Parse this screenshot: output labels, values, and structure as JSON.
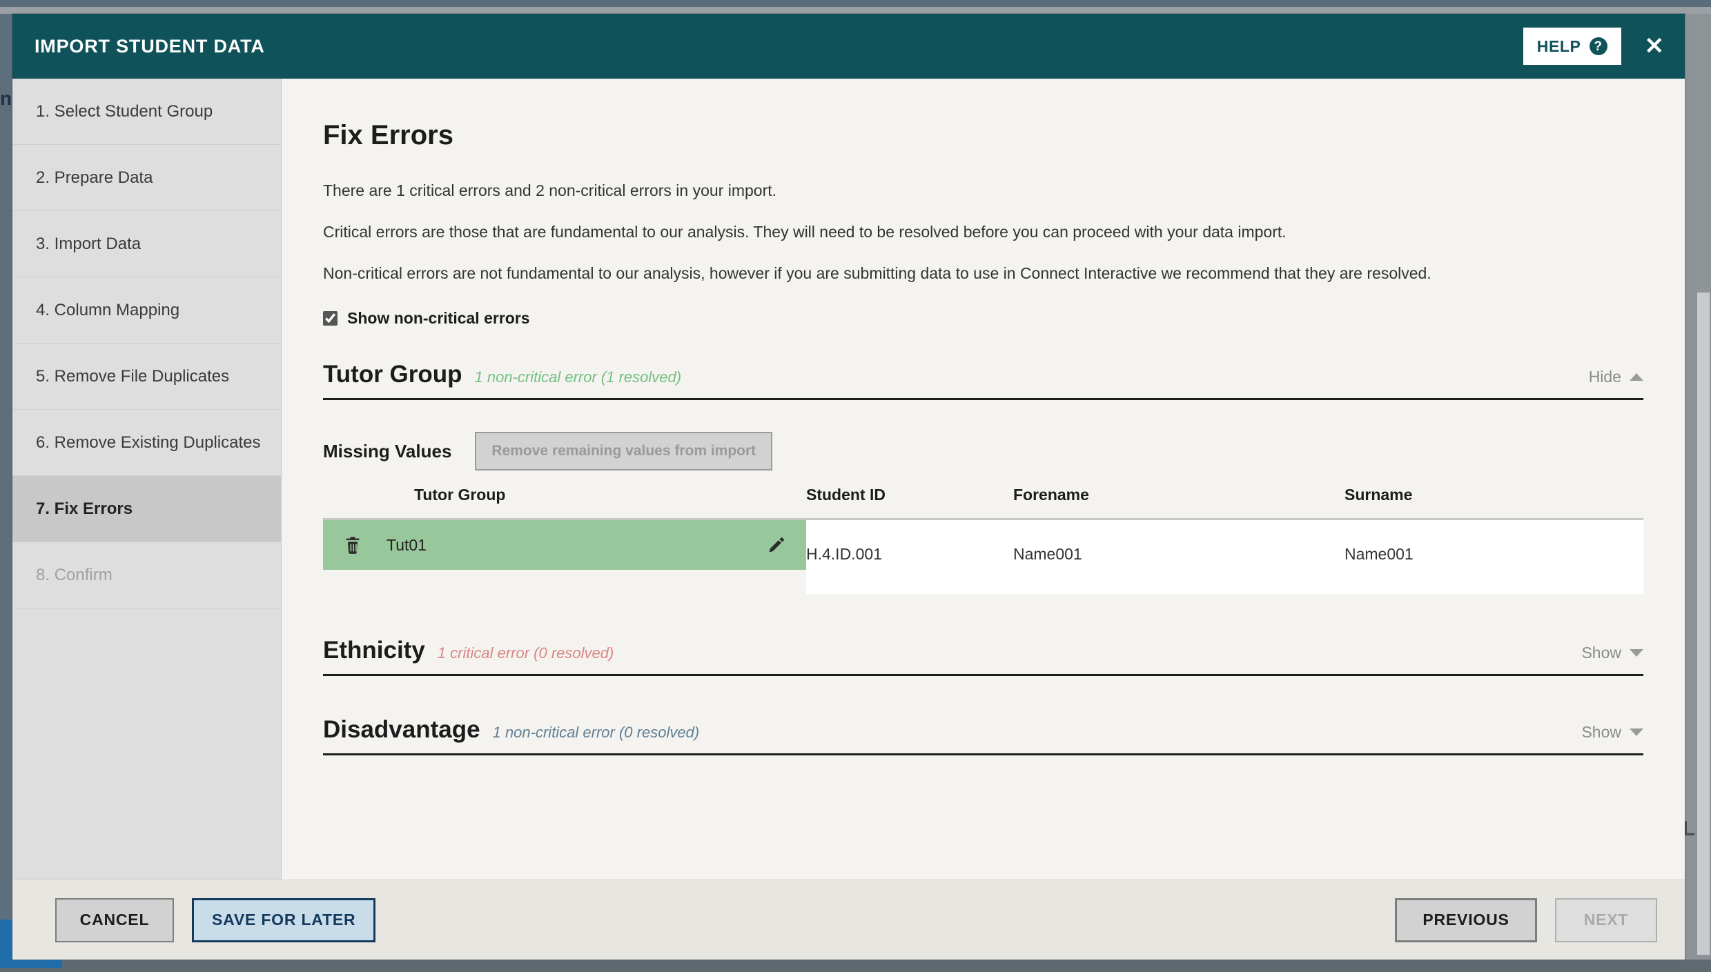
{
  "window": {
    "title": "IMPORT STUDENT DATA",
    "help_label": "HELP",
    "help_icon": "question-circle-icon",
    "close_icon": "close-icon",
    "header_color": "#0f5259"
  },
  "background": {
    "left_edge_text": "n a c n o j a c G d n u e n",
    "right_edge_text": "CL"
  },
  "sidebar": {
    "items": [
      {
        "label": "1. Select Student Group",
        "state": "done"
      },
      {
        "label": "2. Prepare Data",
        "state": "done"
      },
      {
        "label": "3. Import Data",
        "state": "done"
      },
      {
        "label": "4. Column Mapping",
        "state": "done"
      },
      {
        "label": "5. Remove File Duplicates",
        "state": "done"
      },
      {
        "label": "6. Remove Existing Duplicates",
        "state": "done"
      },
      {
        "label": "7. Fix Errors",
        "state": "active"
      },
      {
        "label": "8. Confirm",
        "state": "disabled"
      }
    ]
  },
  "content": {
    "page_title": "Fix Errors",
    "paragraphs": [
      "There are 1 critical errors and 2 non-critical errors in your import.",
      "Critical errors are those that are fundamental to our analysis. They will need to be resolved before you can proceed with your data import.",
      "Non-critical errors are not fundamental to our analysis, however if you are submitting data to use in Connect Interactive we recommend that they are resolved."
    ],
    "checkbox": {
      "label": "Show non-critical errors",
      "checked": true
    },
    "sections": [
      {
        "name": "Tutor Group",
        "status": "1 non-critical error (1 resolved)",
        "status_color": "#74bf82",
        "toggle_label": "Hide",
        "expanded": true
      },
      {
        "name": "Ethnicity",
        "status": "1 critical error (0 resolved)",
        "status_color": "#d98686",
        "toggle_label": "Show",
        "expanded": false
      },
      {
        "name": "Disadvantage",
        "status": "1 non-critical error (0 resolved)",
        "status_color": "#5f7f95",
        "toggle_label": "Show",
        "expanded": false
      }
    ],
    "missing_values": {
      "label": "Missing Values",
      "button_label": "Remove remaining values from import",
      "button_disabled": true
    },
    "table": {
      "headers": [
        "Tutor Group",
        "Student ID",
        "Forename",
        "Surname"
      ],
      "rows": [
        {
          "value": "Tut01",
          "student_id": "H.4.ID.001",
          "forename": "Name001",
          "surname": "Name001",
          "resolved": true,
          "delete_icon": "trash-icon",
          "edit_icon": "pencil-icon",
          "highlight_color": "#97c79a"
        }
      ]
    }
  },
  "footer": {
    "cancel_label": "CANCEL",
    "save_for_later_label": "SAVE FOR LATER",
    "previous_label": "PREVIOUS",
    "next_label": "NEXT",
    "next_disabled": true
  }
}
